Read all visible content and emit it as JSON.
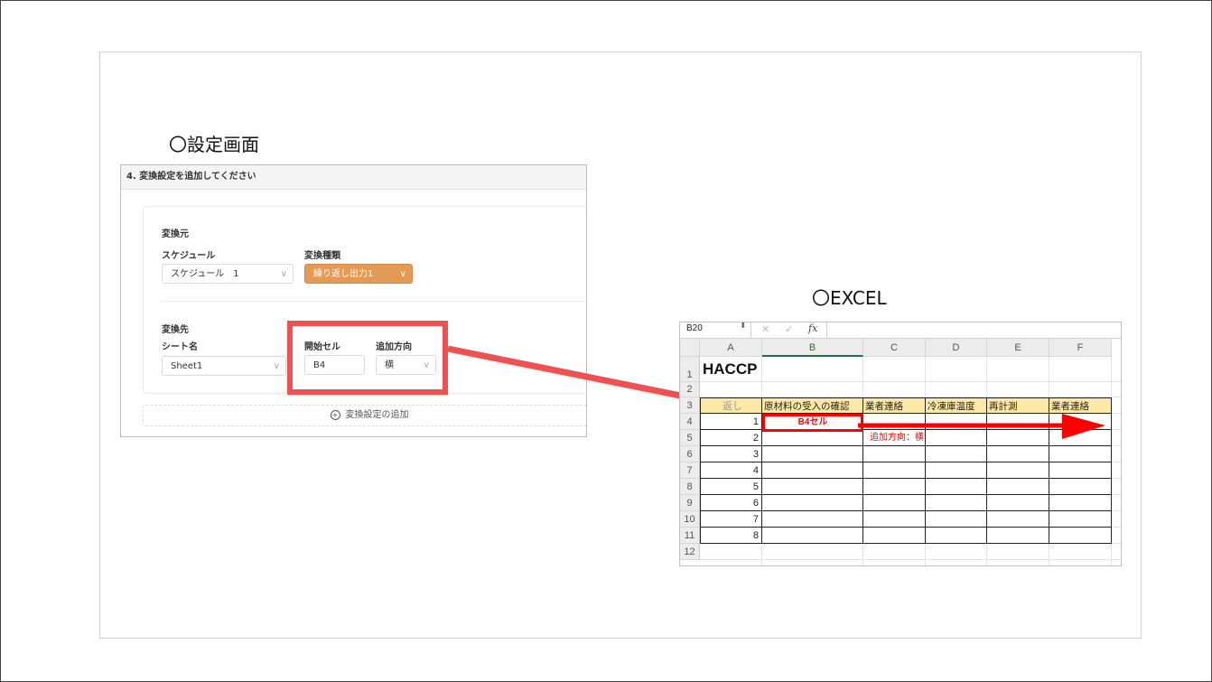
{
  "slide": {
    "settings_heading": "〇設定画面",
    "excel_heading": "〇EXCEL"
  },
  "settings_panel": {
    "header": "4. 変換設定を追加してください",
    "source_section": "変換元",
    "schedule_label": "スケジュール",
    "schedule_value": "スケジュール　1",
    "conversion_type_label": "変換種類",
    "conversion_type_value": "繰り返し出力1",
    "dest_section": "変換先",
    "sheet_name_label": "シート名",
    "sheet_name_value": "Sheet1",
    "start_cell_label": "開始セル",
    "start_cell_value": "B4",
    "direction_label": "追加方向",
    "direction_value": "横",
    "add_button": "変換設定の追加",
    "highlight_color": "#f05050",
    "accent_color": "#e39a55"
  },
  "excel": {
    "name_box": "B20",
    "fx_label": "fx",
    "cancel_icon": "✕",
    "confirm_icon": "✓",
    "columns": [
      "A",
      "B",
      "C",
      "D",
      "E",
      "F"
    ],
    "rows": [
      "1",
      "2",
      "3",
      "4",
      "5",
      "6",
      "7",
      "8",
      "9",
      "10",
      "11",
      "12"
    ],
    "title": "HACCP",
    "a3_partial": "返し",
    "headers": [
      "原材料の受入の確認",
      "業者連絡",
      "冷凍庫温度",
      "再計測",
      "業者連絡"
    ],
    "numbers": [
      "1",
      "2",
      "3",
      "4",
      "5",
      "6",
      "7",
      "8"
    ],
    "b4_label": "B4セル",
    "direction_note": "追加方向：横",
    "header_fill": "#fde8a6",
    "arrow_color": "#ff0000"
  }
}
